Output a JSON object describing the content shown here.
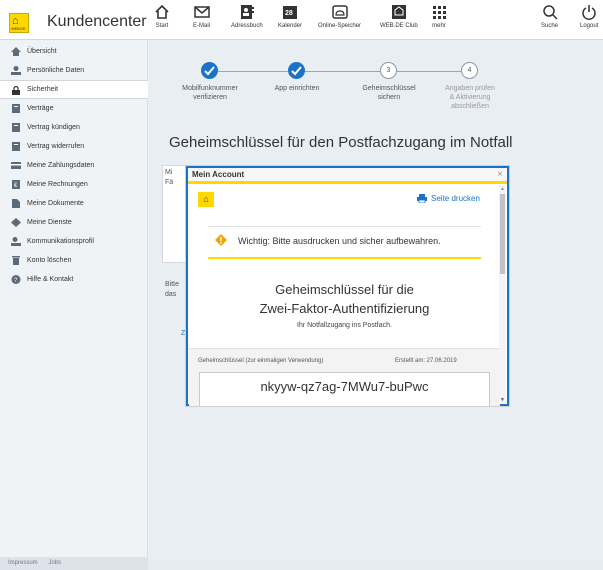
{
  "header": {
    "brand": "Kundencenter",
    "logo_text": "WEB.DE",
    "nav": [
      {
        "label": "Start",
        "icon": "home-icon"
      },
      {
        "label": "E-Mail",
        "icon": "mail-icon"
      },
      {
        "label": "Adressbuch",
        "icon": "addressbook-icon"
      },
      {
        "label": "Kalender",
        "icon": "calendar-icon",
        "badge": "28"
      },
      {
        "label": "Online-Speicher",
        "icon": "cloud-icon"
      },
      {
        "label": "WEB.DE Club",
        "icon": "club-icon"
      },
      {
        "label": "mehr",
        "icon": "apps-grid-icon"
      },
      {
        "label": "Suche",
        "icon": "search-icon"
      },
      {
        "label": "Logout",
        "icon": "power-icon"
      }
    ]
  },
  "sidebar": {
    "items": [
      {
        "label": "Übersicht",
        "icon": "home-icon"
      },
      {
        "label": "Persönliche Daten",
        "icon": "person-icon"
      },
      {
        "label": "Sicherheit",
        "icon": "lock-icon",
        "active": true
      },
      {
        "label": "Verträge",
        "icon": "contract-icon"
      },
      {
        "label": "Vertrag kündigen",
        "icon": "contract-icon"
      },
      {
        "label": "Vertrag widerrufen",
        "icon": "contract-icon"
      },
      {
        "label": "Meine Zahlungsdaten",
        "icon": "card-icon"
      },
      {
        "label": "Meine Rechnungen",
        "icon": "invoice-icon"
      },
      {
        "label": "Meine Dokumente",
        "icon": "document-icon"
      },
      {
        "label": "Meine Dienste",
        "icon": "services-icon"
      },
      {
        "label": "Kommunikationsprofil",
        "icon": "profile-icon"
      },
      {
        "label": "Konto löschen",
        "icon": "trash-icon"
      },
      {
        "label": "Hilfe & Kontakt",
        "icon": "help-icon"
      }
    ],
    "footer": [
      "Impressum",
      "Jobs"
    ]
  },
  "wizard": {
    "steps": [
      {
        "label": "Mobilfunknummer verifizieren",
        "status": "done"
      },
      {
        "label": "App einrichten",
        "status": "done"
      },
      {
        "label": "Geheimschlüssel sichern",
        "status": "current",
        "number": "3"
      },
      {
        "label": "Angaben prüfen & Aktivierung abschließen",
        "status": "todo",
        "number": "4"
      }
    ],
    "step_labels_lines": [
      [
        "Mobilfunknummer",
        "verifizieren"
      ],
      [
        "App einrichten"
      ],
      [
        "Geheimschlüssel",
        "sichern"
      ],
      [
        "Angaben prüfen",
        "& Aktivierung",
        "abschließen"
      ]
    ]
  },
  "main": {
    "title": "Geheimschlüssel für den Postfachzugang im Notfall",
    "ghost_a": "Mi",
    "ghost_b": "Fä",
    "ghost_c": "Bitte",
    "ghost_d": "das",
    "ghost_link": "Zu"
  },
  "dialog": {
    "title": "Mein Account",
    "close": "×",
    "print_label": "Seite drucken",
    "warning": "Wichtig: Bitte ausdrucken und sicher aufbewahren.",
    "heading_line1": "Geheimschlüssel für die",
    "heading_line2": "Zwei-Faktor-Authentifizierung",
    "subheading": "Ihr Notfallzugang ins Postfach.",
    "key_label": "Geheimschlüssel (zur einmaligen Verwendung)",
    "created": "Erstellt am: 27.06.2019",
    "key": "nkyyw-qz7ag-7MWu7-buPwc"
  },
  "colors": {
    "accent_blue": "#1a73c9",
    "brand_yellow": "#ffd800"
  }
}
